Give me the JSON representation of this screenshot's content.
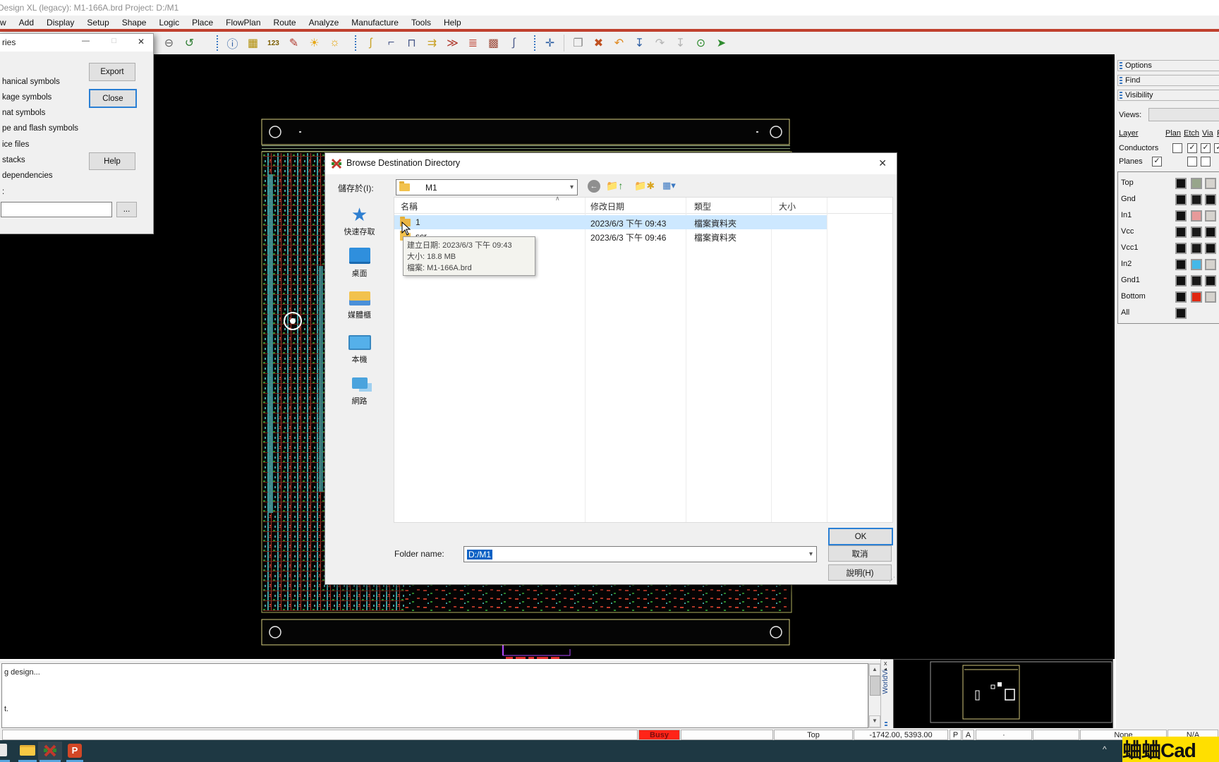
{
  "app": {
    "title": "Design XL (legacy): M1-166A.brd  Project: D:/M1"
  },
  "menu": {
    "items": [
      "w",
      "Add",
      "Display",
      "Setup",
      "Shape",
      "Logic",
      "Place",
      "FlowPlan",
      "Route",
      "Analyze",
      "Manufacture",
      "Tools",
      "Help"
    ]
  },
  "toolbar": {
    "icons": [
      {
        "name": "zoom-out",
        "glyph": "⊖"
      },
      {
        "name": "zoom-dynamic",
        "glyph": "↺"
      },
      {
        "name": "show-element",
        "glyph": "ⓘ"
      },
      {
        "name": "component-info",
        "glyph": "▦"
      },
      {
        "name": "measure",
        "glyph": "123"
      },
      {
        "name": "color-edit",
        "glyph": "✎"
      },
      {
        "name": "shadow-mode",
        "glyph": "☀"
      },
      {
        "name": "dim-mode",
        "glyph": "☼"
      },
      {
        "name": "add-connect",
        "glyph": "ʃ"
      },
      {
        "name": "route-fanout",
        "glyph": "⌐"
      },
      {
        "name": "route-pin",
        "glyph": "⊓"
      },
      {
        "name": "slide",
        "glyph": "⇉"
      },
      {
        "name": "spread",
        "glyph": "≫"
      },
      {
        "name": "delay-tune",
        "glyph": "≣"
      },
      {
        "name": "swap",
        "glyph": "▩"
      },
      {
        "name": "wave",
        "glyph": "∫"
      },
      {
        "name": "move",
        "glyph": "✛"
      },
      {
        "name": "copy",
        "glyph": "❐"
      },
      {
        "name": "delete",
        "glyph": "✖"
      },
      {
        "name": "oops",
        "glyph": "↶"
      },
      {
        "name": "drop",
        "glyph": "↧"
      },
      {
        "name": "redo",
        "glyph": "↷"
      },
      {
        "name": "drop-disabled",
        "glyph": "↧"
      },
      {
        "name": "highlight",
        "glyph": "⊙"
      },
      {
        "name": "pin",
        "glyph": "➤"
      }
    ]
  },
  "export_dialog": {
    "title": "ries",
    "window": {
      "minimize": "—",
      "maximize": "□",
      "close": "✕"
    },
    "items": [
      "hanical symbols",
      "kage symbols",
      "nat symbols",
      "pe and flash symbols",
      "ice files",
      "stacks",
      "dependencies"
    ],
    "field_label": ":",
    "field_value": "",
    "browse_label": "...",
    "buttons": {
      "export": "Export",
      "close": "Close",
      "help": "Help"
    }
  },
  "browse_dialog": {
    "title": "Browse Destination Directory",
    "close": "✕",
    "save_in_label": "儲存於(I):",
    "save_in_value": "M1",
    "sort_indicator": "∧",
    "columns": [
      "名稱",
      "修改日期",
      "類型",
      "大小"
    ],
    "sidebar": [
      {
        "label": "快速存取"
      },
      {
        "label": "桌面"
      },
      {
        "label": "媒體櫃"
      },
      {
        "label": "本機"
      },
      {
        "label": "網路"
      }
    ],
    "rows": [
      {
        "name": "1",
        "modified": "2023/6/3 下午 09:43",
        "type": "檔案資料夾",
        "size": ""
      },
      {
        "name": "scr",
        "modified": "2023/6/3 下午 09:46",
        "type": "檔案資料夾",
        "size": ""
      }
    ],
    "tooltip": {
      "line1": "建立日期: 2023/6/3 下午 09:43",
      "line2": "大小: 18.8 MB",
      "line3": "檔案: M1-166A.brd"
    },
    "folder_name_label": "Folder name:",
    "folder_name_value": "D:/M1",
    "buttons": {
      "ok": "OK",
      "cancel": "取消",
      "help": "說明(H)"
    }
  },
  "right_panel": {
    "panes": [
      "Options",
      "Find",
      "Visibility"
    ],
    "views_label": "Views:",
    "views_value": "",
    "headers": [
      "Layer",
      "Plan",
      "Etch",
      "Via",
      "F"
    ],
    "conductors": {
      "label": "Conductors",
      "checks": [
        "",
        "✓",
        "✓",
        "✓"
      ]
    },
    "planes": {
      "label": "Planes",
      "checks": [
        "✓",
        "",
        ""
      ]
    },
    "layers": [
      {
        "name": "Top",
        "color": "#97a58b"
      },
      {
        "name": "Gnd",
        "color": "#1a1a1a"
      },
      {
        "name": "In1",
        "color": "#e79a9a"
      },
      {
        "name": "Vcc",
        "color": "#1a1a1a"
      },
      {
        "name": "Vcc1",
        "color": "#1a1a1a"
      },
      {
        "name": "In2",
        "color": "#45b8e8"
      },
      {
        "name": "Gnd1",
        "color": "#1a1a1a"
      },
      {
        "name": "Bottom",
        "color": "#e02711"
      },
      {
        "name": "All",
        "color": "#1a1a1a"
      }
    ]
  },
  "console": {
    "line1": "g design...",
    "line2": "t."
  },
  "worldview": {
    "label": "WorldVi",
    "close": "x",
    "collapse": "◂"
  },
  "statusbar": {
    "busy": "Busy",
    "layer": "Top",
    "coords": "-1742.00, 5393.00",
    "p": "P",
    "a": "A",
    "dot": "·",
    "none": "None",
    "na": "N/A"
  },
  "watermark": {
    "text": "蛐蛐Cad"
  }
}
